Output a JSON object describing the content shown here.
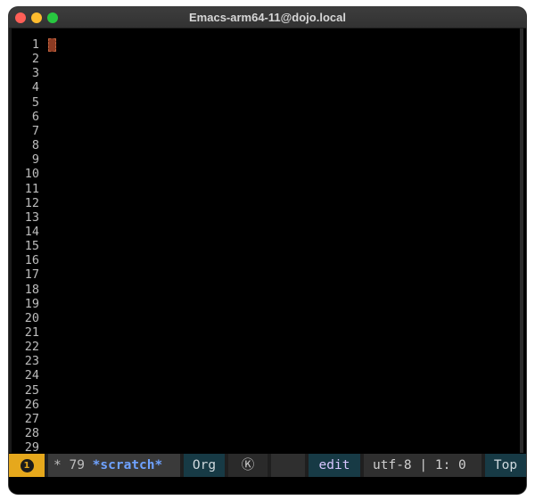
{
  "window": {
    "title": "Emacs-arm64-11@dojo.local"
  },
  "editor": {
    "line_numbers": [
      "1",
      "2",
      "3",
      "4",
      "5",
      "6",
      "7",
      "8",
      "9",
      "10",
      "11",
      "12",
      "13",
      "14",
      "15",
      "16",
      "17",
      "18",
      "19",
      "20",
      "21",
      "22",
      "23",
      "24",
      "25",
      "26",
      "27",
      "28",
      "29"
    ],
    "cursor_color": "#8b3a22"
  },
  "modeline": {
    "error_count": "1",
    "modified_indicator": "*",
    "buffer_size": "79",
    "buffer_name": "*scratch*",
    "major_mode": "Org",
    "k_indicator": "Ⓚ",
    "edit_state": "edit",
    "encoding": "utf-8",
    "position": "1: 0",
    "scroll_position": "Top",
    "colors": {
      "error_bg": "#e6a81c",
      "accent_bg": "#173a45",
      "buffer_name": "#6fa2ff"
    }
  }
}
